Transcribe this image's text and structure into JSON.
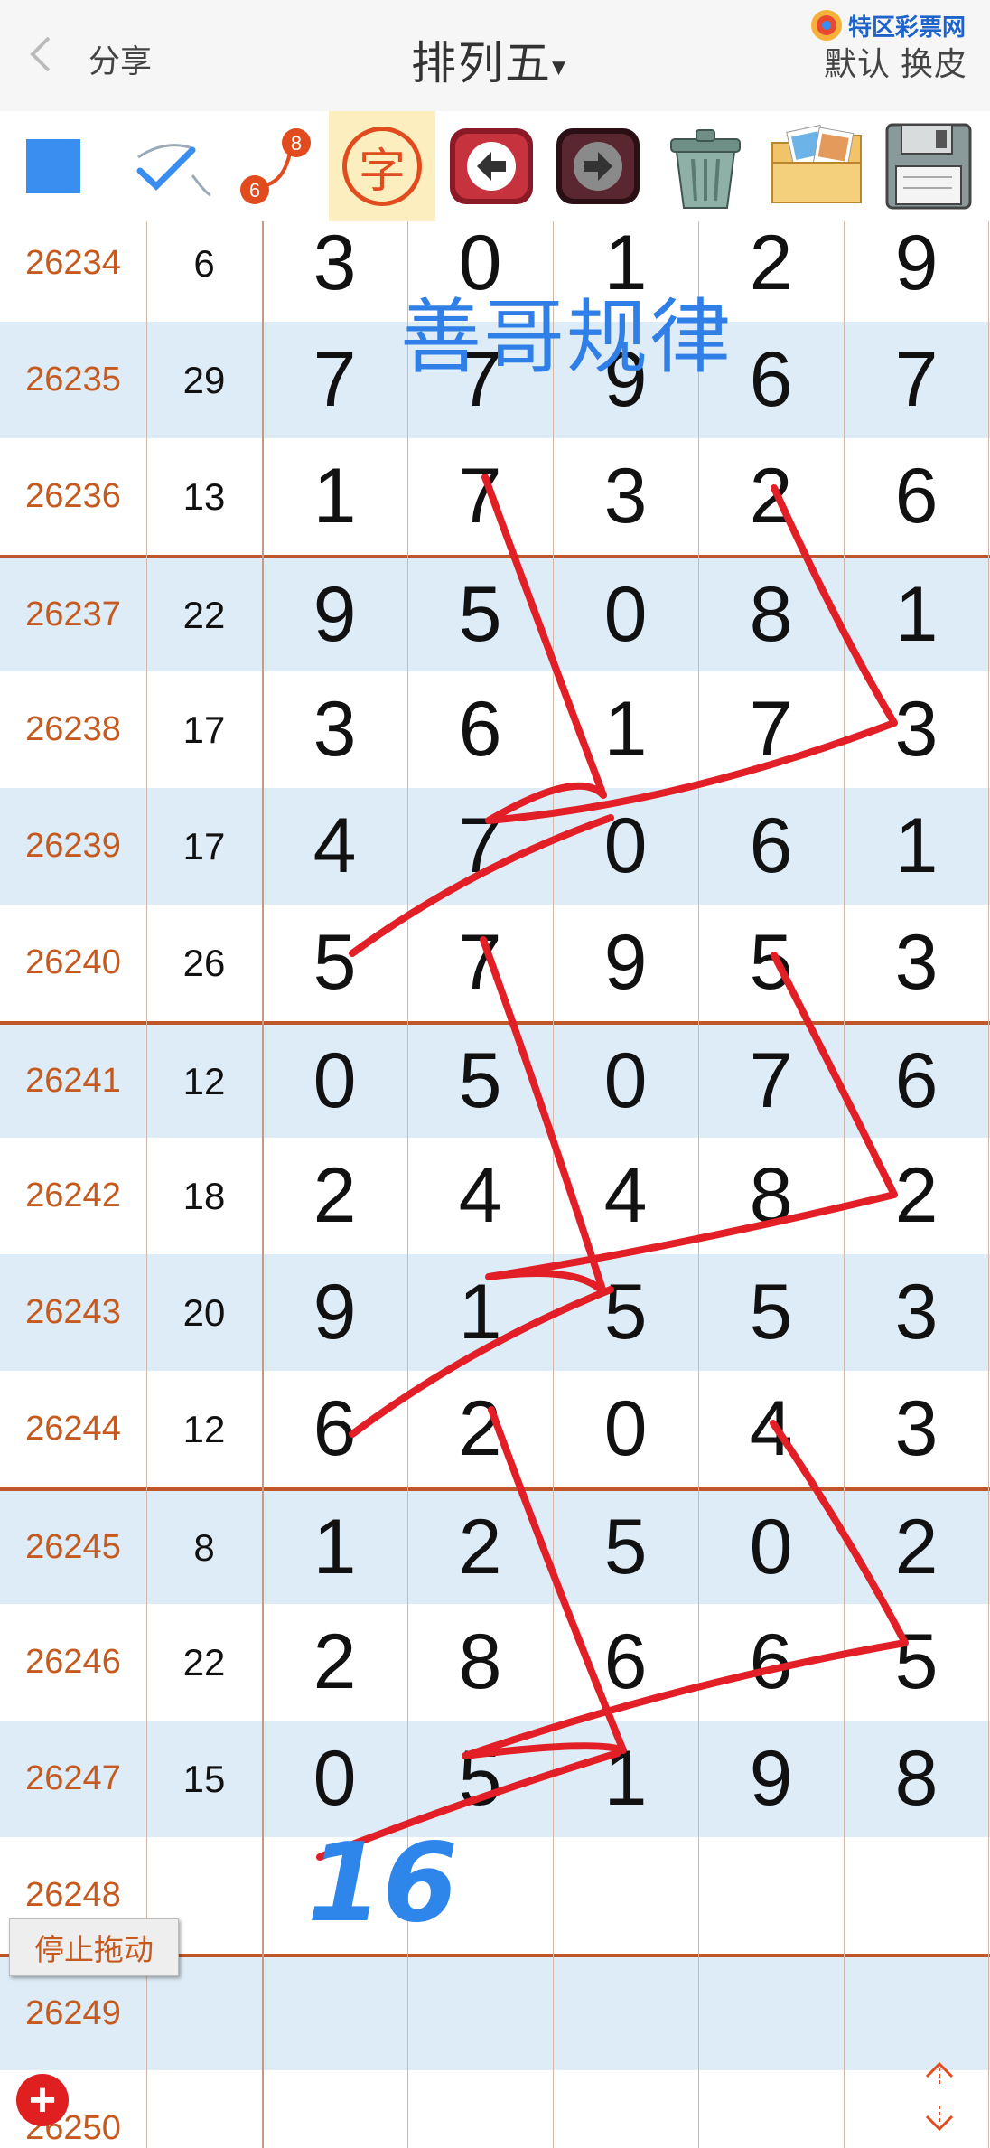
{
  "header": {
    "share_label": "分享",
    "title": "排列五",
    "title_caret": "▾",
    "skin_label": "默认 换皮",
    "brand_text": "特区彩票网"
  },
  "toolbar": {
    "tools": [
      {
        "name": "color-square-icon"
      },
      {
        "name": "pen-check-icon"
      },
      {
        "name": "connect-dots-icon",
        "label_a": "6",
        "label_b": "8"
      },
      {
        "name": "text-char-icon",
        "label": "字"
      },
      {
        "name": "undo-arrow-icon"
      },
      {
        "name": "redo-arrow-icon"
      },
      {
        "name": "trash-icon"
      },
      {
        "name": "photo-folder-icon"
      },
      {
        "name": "save-disk-icon"
      }
    ],
    "colors": {
      "blue": "#3a8ef0",
      "red": "#e14b1e"
    }
  },
  "rows": [
    {
      "issue": "26234",
      "sum": "6",
      "d": [
        "3",
        "0",
        "1",
        "2",
        "9"
      ]
    },
    {
      "issue": "26235",
      "sum": "29",
      "d": [
        "7",
        "7",
        "9",
        "6",
        "7"
      ]
    },
    {
      "issue": "26236",
      "sum": "13",
      "d": [
        "1",
        "7",
        "3",
        "2",
        "6"
      ]
    },
    {
      "issue": "26237",
      "sum": "22",
      "d": [
        "9",
        "5",
        "0",
        "8",
        "1"
      ]
    },
    {
      "issue": "26238",
      "sum": "17",
      "d": [
        "3",
        "6",
        "1",
        "7",
        "3"
      ]
    },
    {
      "issue": "26239",
      "sum": "17",
      "d": [
        "4",
        "7",
        "0",
        "6",
        "1"
      ]
    },
    {
      "issue": "26240",
      "sum": "26",
      "d": [
        "5",
        "7",
        "9",
        "5",
        "3"
      ]
    },
    {
      "issue": "26241",
      "sum": "12",
      "d": [
        "0",
        "5",
        "0",
        "7",
        "6"
      ]
    },
    {
      "issue": "26242",
      "sum": "18",
      "d": [
        "2",
        "4",
        "4",
        "8",
        "2"
      ]
    },
    {
      "issue": "26243",
      "sum": "20",
      "d": [
        "9",
        "1",
        "5",
        "5",
        "3"
      ]
    },
    {
      "issue": "26244",
      "sum": "12",
      "d": [
        "6",
        "2",
        "0",
        "4",
        "3"
      ]
    },
    {
      "issue": "26245",
      "sum": "8",
      "d": [
        "1",
        "2",
        "5",
        "0",
        "2"
      ]
    },
    {
      "issue": "26246",
      "sum": "22",
      "d": [
        "2",
        "8",
        "6",
        "6",
        "5"
      ]
    },
    {
      "issue": "26247",
      "sum": "15",
      "d": [
        "0",
        "5",
        "1",
        "9",
        "8"
      ]
    },
    {
      "issue": "26248",
      "sum": "",
      "d": [
        "",
        "",
        "",
        "",
        ""
      ]
    },
    {
      "issue": "26249",
      "sum": "",
      "d": [
        "",
        "",
        "",
        "",
        ""
      ]
    },
    {
      "issue": "26250",
      "sum": "",
      "d": [
        "",
        "",
        "",
        "",
        ""
      ]
    }
  ],
  "annotations": {
    "title_text": "善哥规律",
    "prediction": "16",
    "stroke_color": "#e21f26",
    "text_color": "#2f7fe6"
  },
  "buttons": {
    "stop_drag_label": "停止拖动",
    "add_label": "+"
  }
}
